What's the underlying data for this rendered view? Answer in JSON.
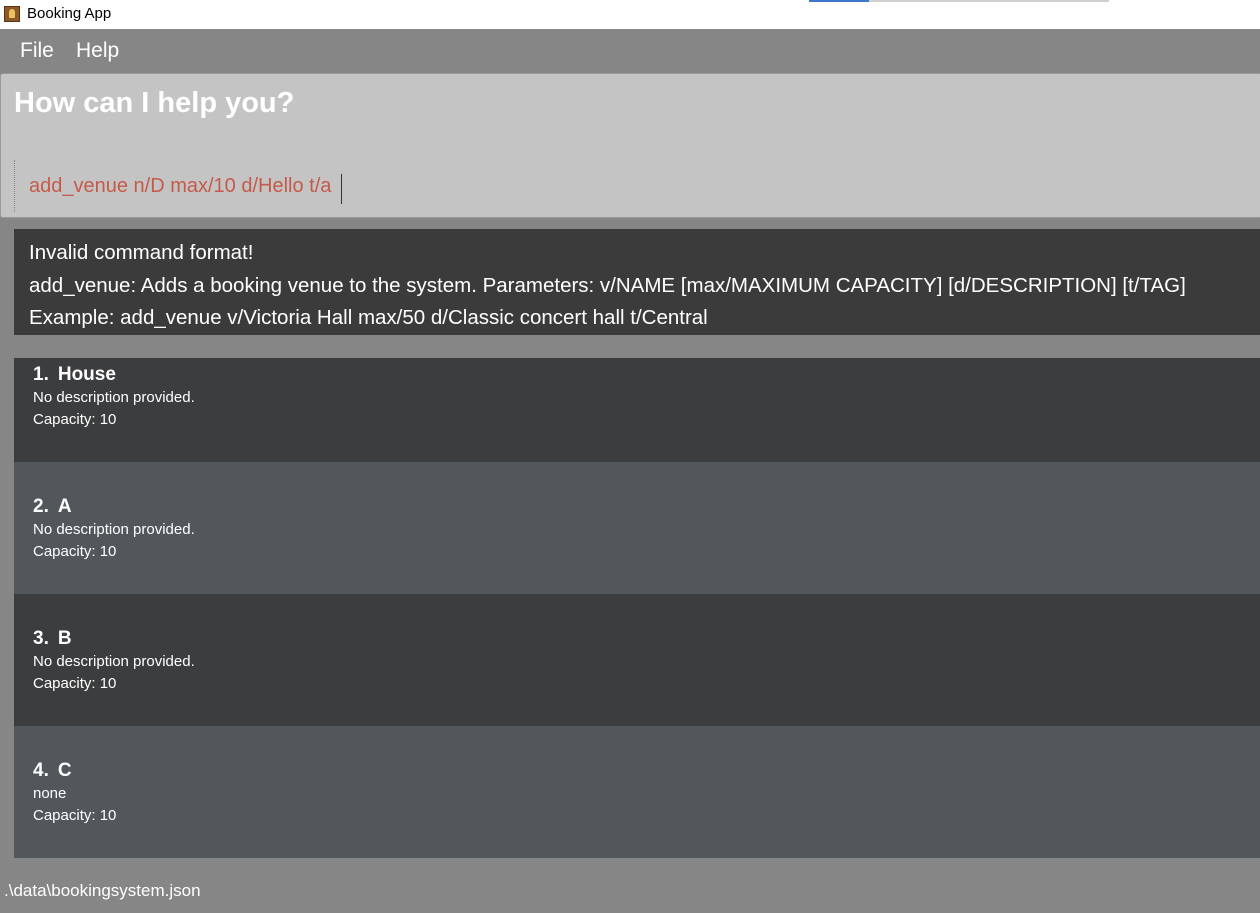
{
  "window": {
    "title": "Booking App"
  },
  "menu": {
    "file": "File",
    "help": "Help"
  },
  "command": {
    "heading": "How can I help you?",
    "input_value": "add_venue n/D max/10 d/Hello t/a"
  },
  "result": {
    "lines": [
      "Invalid command format!",
      "add_venue: Adds a booking venue to the system. Parameters: v/NAME [max/MAXIMUM CAPACITY] [d/DESCRIPTION] [t/TAG]",
      "Example: add_venue v/Victoria Hall max/50 d/Classic concert hall t/Central"
    ]
  },
  "venues": [
    {
      "index": "1.",
      "name": "House",
      "description": "No description provided.",
      "capacity": "Capacity: 10"
    },
    {
      "index": "2.",
      "name": "A",
      "description": "No description provided.",
      "capacity": "Capacity: 10"
    },
    {
      "index": "3.",
      "name": "B",
      "description": "No description provided.",
      "capacity": "Capacity: 10"
    },
    {
      "index": "4.",
      "name": "C",
      "description": "none",
      "capacity": "Capacity: 10"
    }
  ],
  "status": {
    "file_path": ".\\data\\bookingsystem.json"
  },
  "colors": {
    "background": "#868686",
    "command_text": "#c65a4a",
    "card_dark": "#3c3d3f",
    "card_light": "#51575a",
    "result_bg": "#3b3b3b"
  },
  "icons": {
    "app": "booking-app-icon"
  }
}
